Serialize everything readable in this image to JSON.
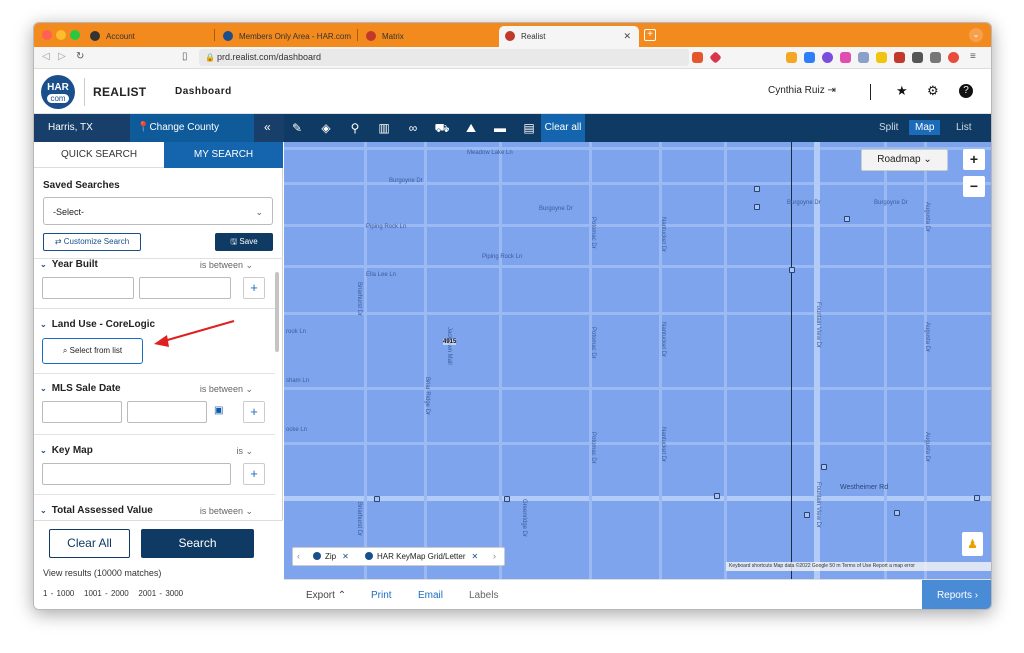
{
  "browser": {
    "tabs": [
      {
        "label": "Account"
      },
      {
        "label": "Members Only Area - HAR.com"
      },
      {
        "label": "Matrix"
      },
      {
        "label": "Realist"
      }
    ],
    "new_tab": "+",
    "url": "prd.realist.com/dashboard"
  },
  "header": {
    "logo_top": "HAR",
    "logo_bottom": "com",
    "brand": "REALIST",
    "nav": "Dashboard",
    "user": "Cynthia Ruiz"
  },
  "toolbar": {
    "location": "Harris, TX",
    "change_county": "Change County",
    "clear_all": "Clear all",
    "views": [
      "Split",
      "Map",
      "List"
    ],
    "active_view": "Map"
  },
  "sidebar": {
    "tabs": [
      "QUICK SEARCH",
      "MY SEARCH"
    ],
    "active_tab": "MY SEARCH",
    "saved_searches_title": "Saved Searches",
    "saved_select": "-Select-",
    "customize_btn": "Customize Search",
    "save_btn": "Save",
    "filters": [
      {
        "label": "Year Built",
        "op": "is between"
      },
      {
        "label": "Land Use - CoreLogic",
        "op": ""
      },
      {
        "label": "MLS Sale Date",
        "op": "is between"
      },
      {
        "label": "Key Map",
        "op": "is"
      },
      {
        "label": "Total Assessed Value",
        "op": "is between"
      }
    ],
    "select_from_list": "Select from list",
    "clear_all_btn": "Clear All",
    "search_btn": "Search",
    "results": "View results (10000 matches)",
    "pages": [
      "1 - 1000",
      "1001 - 2000",
      "2001 - 3000"
    ]
  },
  "map": {
    "roadmap": "Roadmap",
    "zoom_in": "+",
    "zoom_out": "−",
    "marker": "4915",
    "layers": [
      {
        "label": "Zip"
      },
      {
        "label": "HAR KeyMap Grid/Letter"
      }
    ],
    "footer": "Keyboard shortcuts   Map data ©2022 Google   50 m   Terms of Use   Report a map error",
    "streets": {
      "meadow": "Meadow Lake Ln",
      "burgoyne1": "Burgoyne Dr",
      "burgoyne2": "Burgoyne Dr",
      "burgoyne3": "Burgoyne Dr",
      "burgoyne4": "Burgoyne Dr",
      "piping1": "Piping Rock Ln",
      "piping2": "Piping Rock Ln",
      "ella": "Ella Lee Ln",
      "brook": "rook Ln",
      "sham": "sham Ln",
      "ocke": "ocke Ln",
      "westheimer": "Westheimer Rd",
      "potomac1": "Potomac Dr",
      "potomac2": "Potomac Dr",
      "potomac3": "Potomac Dr",
      "nantucket1": "Nantucket Dr",
      "nantucket2": "Nantucket Dr",
      "nantucket3": "Nantucket Dr",
      "augusta1": "Augusta Dr",
      "augusta2": "Augusta Dr",
      "augusta3": "Augusta Dr",
      "fountain1": "Fountain View Dr",
      "fountain2": "Fountain View Dr",
      "briarhurst1": "Briarhurst Dr",
      "briarhurst2": "Briarhurst Dr",
      "briarridge": "Briar Ridge Dr",
      "jacktown": "Jacktown Mall",
      "greenridge": "Greenridge Dr"
    }
  },
  "bottombar": {
    "export": "Export",
    "print": "Print",
    "email": "Email",
    "labels": "Labels",
    "reports": "Reports"
  },
  "colors": {
    "navy": "#0e3a63",
    "accent": "#1b6bb8",
    "map": "#7ea4ee",
    "tabbar": "#f38a1e",
    "annotation": "#e02020"
  }
}
